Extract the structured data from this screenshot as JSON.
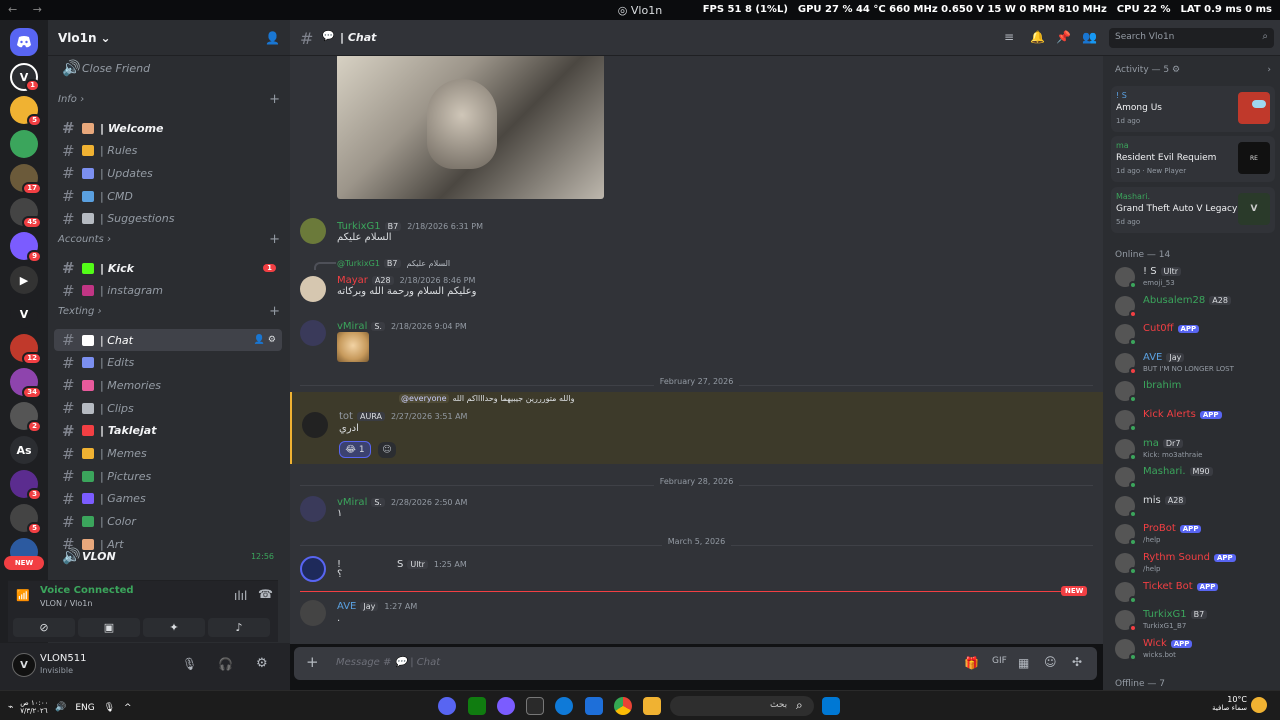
{
  "titlebar": {
    "title": "Vlo1n",
    "fps_label": "FPS",
    "fps": "51",
    "fps_low": "8 (1%L)",
    "gpu_label": "GPU",
    "gpu": "27 % 44 °C 660 MHz 0.650 V 15 W 0 RPM 810 MHz",
    "cpu_label": "CPU",
    "cpu": "22 %",
    "lat_label": "LAT",
    "lat": "0.9 ms 0 ms"
  },
  "server": {
    "name": "Vlo1n",
    "pinned_channel": "Close Friend"
  },
  "categories": [
    {
      "name": "Info",
      "channels": [
        {
          "label": "| Welcome",
          "bold": true,
          "color": "#e8a87c"
        },
        {
          "label": "| Rules",
          "color": "#f0b232"
        },
        {
          "label": "| Updates",
          "color": "#7b8ff0"
        },
        {
          "label": "| CMD",
          "color": "#5aa0e0"
        },
        {
          "label": "| Suggestions",
          "color": "#b5bac1"
        }
      ]
    },
    {
      "name": "Accounts",
      "channels": [
        {
          "label": "| Kick",
          "bold": true,
          "color": "#53fc18",
          "badge": "1"
        },
        {
          "label": "| instagram",
          "color": "#c13584"
        }
      ]
    },
    {
      "name": "Texting",
      "channels": [
        {
          "label": "| Chat",
          "active": true,
          "color": "#ffffff"
        },
        {
          "label": "| Edits",
          "color": "#7b8ff0"
        },
        {
          "label": "| Memories",
          "color": "#e85a9c"
        },
        {
          "label": "| Clips",
          "color": "#b5bac1"
        },
        {
          "label": "| Taklejat",
          "bold": true,
          "color": "#f23f43"
        },
        {
          "label": "| Memes",
          "color": "#f0b232"
        },
        {
          "label": "| Pictures",
          "color": "#3ba55c"
        },
        {
          "label": "| Games",
          "color": "#7b5cff"
        },
        {
          "label": "| Color",
          "color": "#3ba55c"
        },
        {
          "label": "| Art",
          "color": "#e8a87c"
        }
      ]
    }
  ],
  "voice_channel": {
    "name": "VLON",
    "time": "12:56"
  },
  "voice_panel": {
    "status": "Voice Connected",
    "location": "VLON / Vlo1n"
  },
  "user": {
    "name": "VLON511",
    "status": "Invisible"
  },
  "chat_header": {
    "channel": "| Chat",
    "search_placeholder": "Search Vlo1n"
  },
  "messages": [
    {
      "author": "TurkixG1",
      "color": "#3ba55c",
      "tag": "B7",
      "time": "2/18/2026 6:31 PM",
      "text": "السلام عليكم"
    },
    {
      "reply_to": "@TurkixG1",
      "reply_tag": "B7",
      "reply_text": "السلام عليكم",
      "author": "Mayar",
      "color": "#f23f43",
      "tag": "A28",
      "time": "2/18/2026 8:46 PM",
      "text": "وعليكم السلام ورحمة الله وبركاته"
    },
    {
      "author": "vMiral",
      "color": "#3ba55c",
      "tag": "S.",
      "time": "2/18/2026 9:04 PM",
      "text": ""
    },
    {
      "mention": "@everyone",
      "reply_text": "والله متورررين جيبيهما وحدااااكم الله",
      "author": "tot",
      "color": "#949ba4",
      "tag": "AURA",
      "time": "2/27/2026 3:51 AM",
      "text": "ادري",
      "reaction": "1"
    },
    {
      "author": "vMiral",
      "color": "#3ba55c",
      "tag": "S.",
      "time": "2/28/2026 2:50 AM",
      "text": "١"
    },
    {
      "author": "!",
      "color": "#dbdee1",
      "author2": "S",
      "tag": "Ultr",
      "time": "1:25 AM",
      "text": "؟"
    },
    {
      "author": "AVE",
      "color": "#5aa0e0",
      "tag": "Jay",
      "time": "1:27 AM",
      "text": "."
    }
  ],
  "dividers": [
    "February 27, 2026",
    "February 28, 2026",
    "March 5, 2026"
  ],
  "new_label": "NEW",
  "composer_placeholder": "Message #",
  "composer_channel": "| Chat",
  "activity": {
    "header": "Activity — 5",
    "items": [
      {
        "player": "! S",
        "game": "Among Us",
        "ago": "1d ago",
        "color": "#5aa0e0",
        "extra": ""
      },
      {
        "player": "ma",
        "game": "Resident Evil Requiem",
        "ago": "1d ago",
        "color": "#3ba55c",
        "extra": "New Player"
      },
      {
        "player": "Mashari.",
        "game": "Grand Theft Auto V Legacy",
        "ago": "5d ago",
        "color": "#3ba55c",
        "extra": ""
      }
    ]
  },
  "online_header": "Online — 14",
  "members": [
    {
      "name": "! S",
      "tag": "Ultr",
      "sub": "emoji_53",
      "color": "#dbdee1",
      "status": "#3ba55c"
    },
    {
      "name": "Abusalem28",
      "tag": "A28",
      "sub": "",
      "color": "#3ba55c",
      "status": "#f23f43"
    },
    {
      "name": "Cut0ff",
      "tag": "",
      "sub": "",
      "app": "APP",
      "color": "#f23f43",
      "status": "#3ba55c"
    },
    {
      "name": "AVE",
      "tag": "Jay",
      "sub": "BUT I'M NO LONGER LOST",
      "color": "#5aa0e0",
      "status": "#f23f43"
    },
    {
      "name": "Ibrahim",
      "tag": "",
      "sub": "",
      "color": "#3ba55c",
      "status": "#3ba55c"
    },
    {
      "name": "Kick Alerts",
      "tag": "",
      "sub": "",
      "app": "APP",
      "color": "#f23f43",
      "status": "#3ba55c"
    },
    {
      "name": "ma",
      "tag": "Dr7",
      "sub": "Kick: mo3athraie",
      "color": "#3ba55c",
      "status": "#3ba55c"
    },
    {
      "name": "Mashari.",
      "tag": "M90",
      "sub": "",
      "color": "#3ba55c",
      "status": "#3ba55c"
    },
    {
      "name": "mis",
      "tag": "A28",
      "sub": "",
      "color": "#dbdee1",
      "status": "#3ba55c"
    },
    {
      "name": "ProBot",
      "tag": "",
      "sub": "/help",
      "app": "APP",
      "color": "#f23f43",
      "status": "#3ba55c"
    },
    {
      "name": "Rythm Sound",
      "tag": "",
      "sub": "/help",
      "app": "APP",
      "color": "#f23f43",
      "status": "#3ba55c"
    },
    {
      "name": "Ticket Bot",
      "tag": "",
      "sub": "",
      "app": "APP",
      "color": "#f23f43",
      "status": "#3ba55c"
    },
    {
      "name": "TurkixG1",
      "tag": "B7",
      "sub": "TurkixG1_B7",
      "color": "#3ba55c",
      "status": "#f23f43"
    },
    {
      "name": "Wick",
      "tag": "",
      "sub": "wicks.bot",
      "app": "APP",
      "color": "#f23f43",
      "status": "#3ba55c"
    }
  ],
  "offline_header": "Offline — 7",
  "taskbar": {
    "time_ar": "١٠:٠٠ ص",
    "date_ar": "٧/٣/٢٠٢٦",
    "lang": "ENG",
    "search_placeholder": "بحث",
    "temp": "10°C",
    "weather": "سماء صافية"
  }
}
